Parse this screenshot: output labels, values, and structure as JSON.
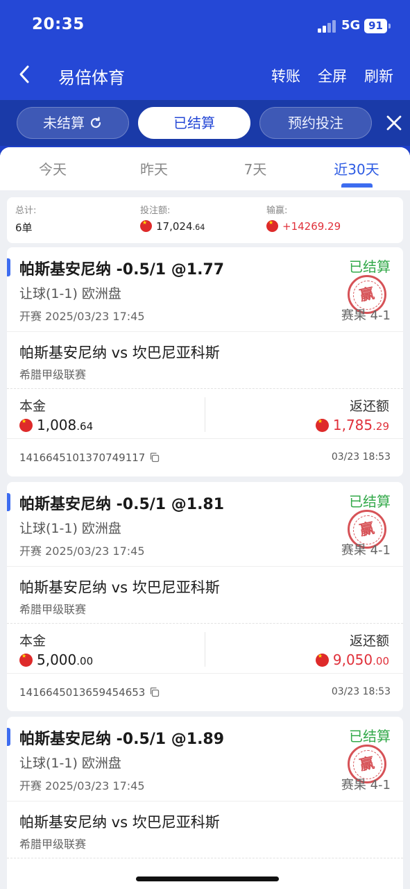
{
  "status_bar": {
    "time": "20:35",
    "network": "5G",
    "battery": "91"
  },
  "nav": {
    "title": "易倍体育",
    "actions": [
      "转账",
      "全屏",
      "刷新"
    ]
  },
  "segments": [
    {
      "label": "未结算",
      "icon": "refresh-icon"
    },
    {
      "label": "已结算"
    },
    {
      "label": "预约投注"
    }
  ],
  "period_tabs": [
    "今天",
    "昨天",
    "7天",
    "近30天"
  ],
  "active_period": "近30天",
  "summary": {
    "total_label": "总计:",
    "total_value": "6单",
    "stake_label": "投注额:",
    "stake_int": "17,024",
    "stake_dec": ".64",
    "win_label": "输赢:",
    "win_value": "+14269.29"
  },
  "bets": [
    {
      "title": "帕斯基安尼纳 -0.5/1 @1.77",
      "status": "已结算",
      "stamp": "赢",
      "market": "让球(1-1) 欧洲盘",
      "kickoff": "开赛 2025/03/23 17:45",
      "result": "赛果 4-1",
      "match": "帕斯基安尼纳 vs 坎巴尼亚科斯",
      "league": "希腊甲级联赛",
      "stake_label": "本金",
      "stake_int": "1,008",
      "stake_dec": ".64",
      "return_label": "返还额",
      "return_int": "1,785",
      "return_dec": ".29",
      "order_id": "1416645101370749117",
      "settle_time": "03/23 18:53"
    },
    {
      "title": "帕斯基安尼纳 -0.5/1 @1.81",
      "status": "已结算",
      "stamp": "赢",
      "market": "让球(1-1) 欧洲盘",
      "kickoff": "开赛 2025/03/23 17:45",
      "result": "赛果 4-1",
      "match": "帕斯基安尼纳 vs 坎巴尼亚科斯",
      "league": "希腊甲级联赛",
      "stake_label": "本金",
      "stake_int": "5,000",
      "stake_dec": ".00",
      "return_label": "返还额",
      "return_int": "9,050",
      "return_dec": ".00",
      "order_id": "1416645013659454653",
      "settle_time": "03/23 18:53"
    },
    {
      "title": "帕斯基安尼纳 -0.5/1 @1.89",
      "status": "已结算",
      "stamp": "赢",
      "market": "让球(1-1) 欧洲盘",
      "kickoff": "开赛 2025/03/23 17:45",
      "result": "赛果 4-1",
      "match": "帕斯基安尼纳 vs 坎巴尼亚科斯",
      "league": "希腊甲级联赛"
    }
  ],
  "colors": {
    "brand_blue": "#2548d6",
    "win_red": "#e0303a",
    "settled_green": "#33a94a"
  }
}
